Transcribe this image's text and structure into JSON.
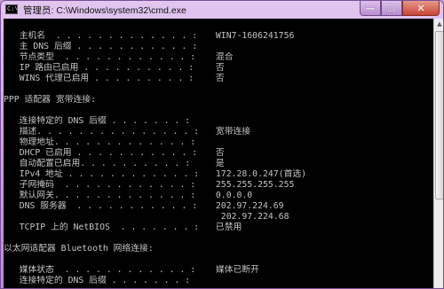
{
  "window": {
    "title": "管理员: C:\\Windows\\system32\\cmd.exe",
    "app_icon_glyph": "C:\\",
    "controls": {
      "minimize": "—",
      "maximize": "☐",
      "close": "✕"
    }
  },
  "console": {
    "lines": [
      {
        "label": "   主机名  . . . . . . . . . . . . . :",
        "value": " WIN7-1606241756"
      },
      {
        "label": "   主 DNS 后缀 . . . . . . . . . . . :",
        "value": ""
      },
      {
        "label": "   节点类型  . . . . . . . . . . . . :",
        "value": " 混合"
      },
      {
        "label": "   IP 路由已启用 . . . . . . . . . . :",
        "value": " 否"
      },
      {
        "label": "   WINS 代理已启用 . . . . . . . . . :",
        "value": " 否"
      },
      {
        "label": "",
        "value": ""
      },
      {
        "label": "PPP 适配器 宽带连接:",
        "value": ""
      },
      {
        "label": "",
        "value": ""
      },
      {
        "label": "   连接特定的 DNS 后缀 . . . . . . . :",
        "value": ""
      },
      {
        "label": "   描述. . . . . . . . . . . . . . . :",
        "value": " 宽带连接"
      },
      {
        "label": "   物理地址. . . . . . . . . . . . . :",
        "value": ""
      },
      {
        "label": "   DHCP 已启用 . . . . . . . . . . . :",
        "value": " 否"
      },
      {
        "label": "   自动配置已启用. . . . . . . . . . :",
        "value": " 是"
      },
      {
        "label": "   IPv4 地址 . . . . . . . . . . . . :",
        "value": " 172.28.0.247(首选)"
      },
      {
        "label": "   子网掩码  . . . . . . . . . . . . :",
        "value": " 255.255.255.255"
      },
      {
        "label": "   默认网关. . . . . . . . . . . . . :",
        "value": " 0.0.0.0"
      },
      {
        "label": "   DNS 服务器  . . . . . . . . . . . :",
        "value": " 202.97.224.69"
      },
      {
        "label": "",
        "value": "  202.97.224.68"
      },
      {
        "label": "   TCPIP 上的 NetBIOS  . . . . . . . :",
        "value": " 已禁用"
      },
      {
        "label": "",
        "value": ""
      },
      {
        "label": "以太网适配器 Bluetooth 网络连接:",
        "value": ""
      },
      {
        "label": "",
        "value": ""
      },
      {
        "label": "   媒体状态  . . . . . . . . . . . . :",
        "value": " 媒体已断开"
      },
      {
        "label": "   连接特定的 DNS 后缀 . . . . . . . :",
        "value": ""
      }
    ]
  },
  "scrollbar": {
    "up_arrow": "▲"
  }
}
